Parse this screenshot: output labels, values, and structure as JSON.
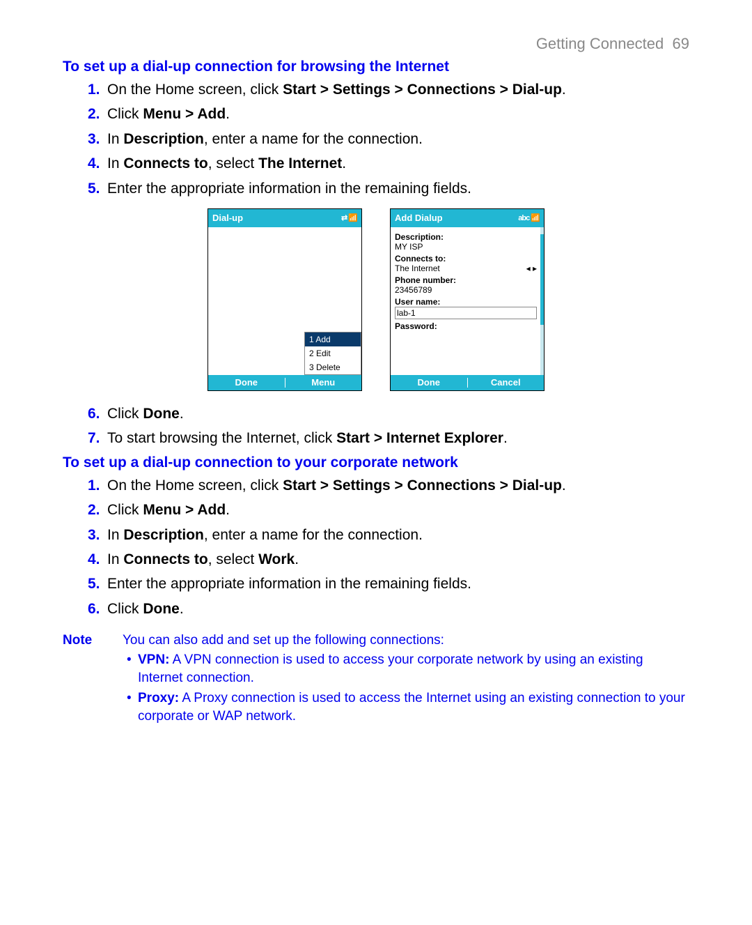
{
  "header": {
    "title": "Getting Connected",
    "page": "69"
  },
  "section1": {
    "title": "To set up a dial-up connection for browsing the Internet",
    "steps_a": [
      {
        "n": "1.",
        "pre": "On the Home screen, click ",
        "bold": "Start > Settings > Connections > Dial-up",
        "post": "."
      },
      {
        "n": "2.",
        "pre": "Click ",
        "bold": "Menu > Add",
        "post": "."
      },
      {
        "n": "3.",
        "pre": "In ",
        "bold": "Description",
        "post": ", enter a name for the connection."
      },
      {
        "n": "4.",
        "pre": "In ",
        "bold": "Connects to",
        "mid": ", select ",
        "bold2": "The Internet",
        "post": "."
      },
      {
        "n": "5.",
        "pre": "Enter the appropriate information in the remaining fields.",
        "bold": "",
        "post": ""
      }
    ],
    "steps_b": [
      {
        "n": "6.",
        "pre": "Click ",
        "bold": "Done",
        "post": "."
      },
      {
        "n": "7.",
        "pre": "To start browsing the Internet, click ",
        "bold": "Start > Internet Explorer",
        "post": "."
      }
    ]
  },
  "phone1": {
    "title": "Dial-up",
    "menu": {
      "i1": "1 Add",
      "i2": "2 Edit",
      "i3": "3 Delete"
    },
    "sk_left": "Done",
    "sk_right": "Menu"
  },
  "phone2": {
    "title": "Add Dialup",
    "abc": "abc",
    "description_lbl": "Description:",
    "description_val": "MY ISP",
    "connects_lbl": "Connects to:",
    "connects_val": "The Internet",
    "phone_lbl": "Phone number:",
    "phone_val": "23456789",
    "user_lbl": "User name:",
    "user_val": "lab-1",
    "pass_lbl": "Password:",
    "sk_left": "Done",
    "sk_right": "Cancel"
  },
  "section2": {
    "title": "To set up a dial-up connection to your corporate network",
    "steps": [
      {
        "n": "1.",
        "pre": "On the Home screen, click ",
        "bold": "Start > Settings > Connections > Dial-up",
        "post": "."
      },
      {
        "n": "2.",
        "pre": "Click ",
        "bold": "Menu > Add",
        "post": "."
      },
      {
        "n": "3.",
        "pre": "In ",
        "bold": "Description",
        "post": ", enter a name for the connection."
      },
      {
        "n": "4.",
        "pre": "In ",
        "bold": "Connects to",
        "mid": ", select ",
        "bold2": "Work",
        "post": "."
      },
      {
        "n": "5.",
        "pre": "Enter the appropriate information in the remaining fields.",
        "bold": "",
        "post": ""
      },
      {
        "n": "6.",
        "pre": "Click ",
        "bold": "Done",
        "post": "."
      }
    ]
  },
  "note": {
    "label": "Note",
    "intro": "You can also add and set up the following connections:",
    "items": [
      {
        "bold": "VPN:",
        "text": " A VPN connection is used to access your corporate network by using an existing Internet connection."
      },
      {
        "bold": "Proxy:",
        "text": " A Proxy connection is used to access the Internet using an existing connection to your corporate or WAP network."
      }
    ]
  }
}
